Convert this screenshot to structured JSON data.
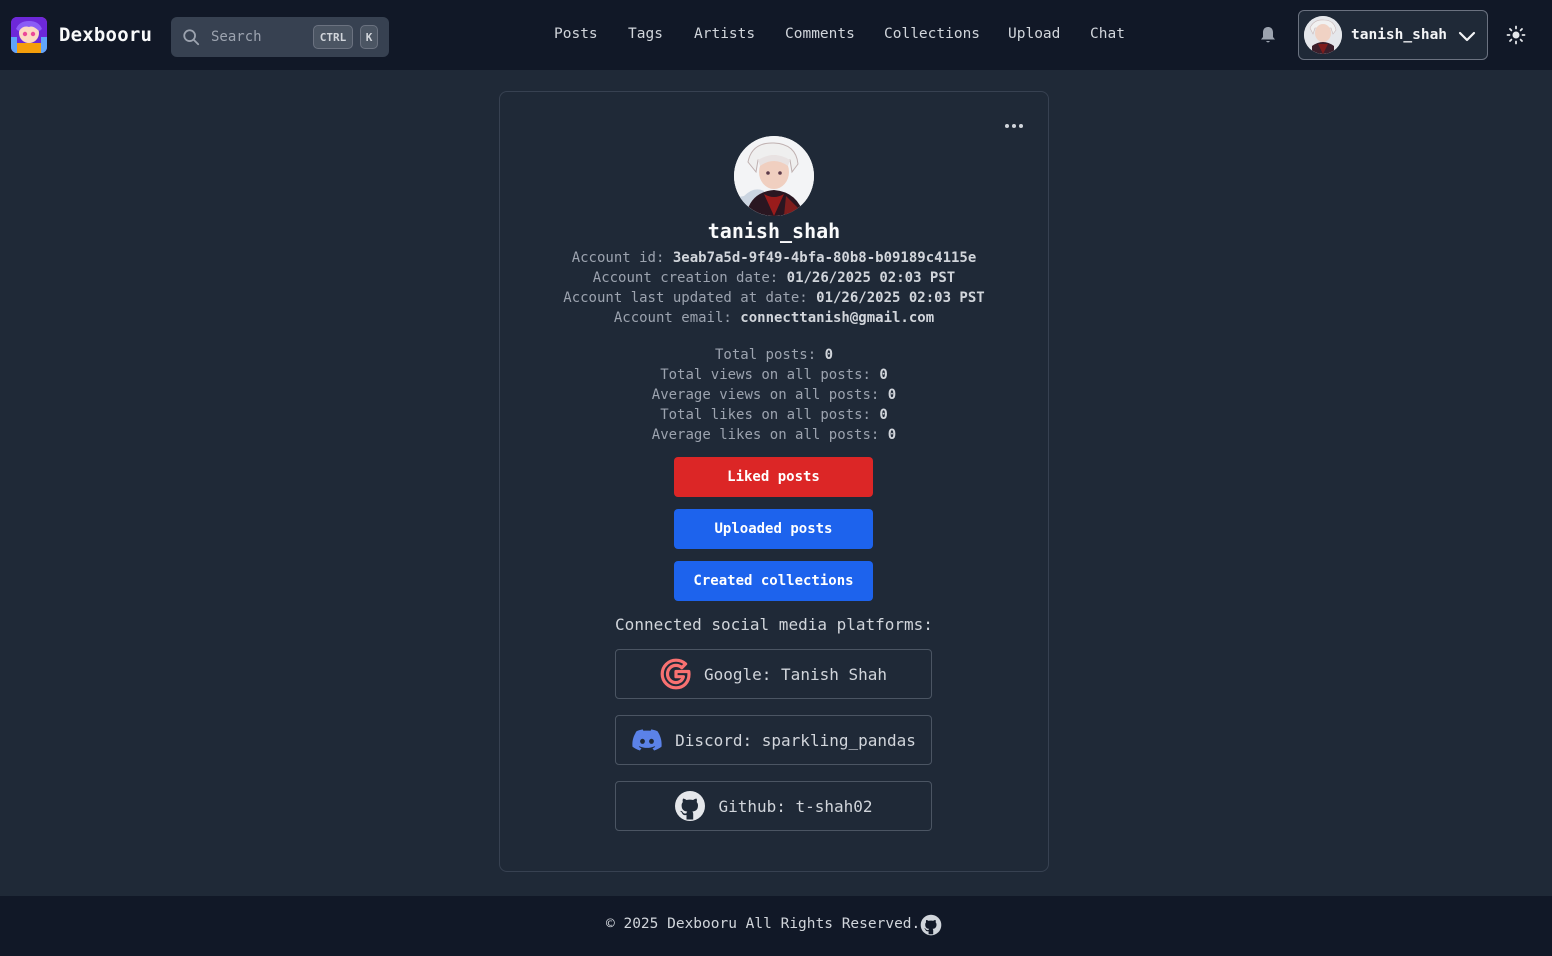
{
  "header": {
    "logo_text": "Dexbooru",
    "search": {
      "placeholder": "Search",
      "kbd_ctrl": "CTRL",
      "kbd_k": "K"
    },
    "nav": [
      "Posts",
      "Tags",
      "Artists",
      "Comments",
      "Collections",
      "Upload",
      "Chat"
    ],
    "user": {
      "name": "tanish_shah"
    }
  },
  "profile": {
    "username": "tanish_shah",
    "account": [
      {
        "label": "Account id: ",
        "value": "3eab7a5d-9f49-4bfa-80b8-b09189c4115e"
      },
      {
        "label": "Account creation date: ",
        "value": "01/26/2025 02:03 PST"
      },
      {
        "label": "Account last updated at date: ",
        "value": "01/26/2025 02:03 PST"
      },
      {
        "label": "Account email: ",
        "value": "connecttanish@gmail.com"
      }
    ],
    "stats": [
      {
        "label": "Total posts: ",
        "value": "0"
      },
      {
        "label": "Total views on all posts: ",
        "value": "0"
      },
      {
        "label": "Average views on all posts: ",
        "value": "0"
      },
      {
        "label": "Total likes on all posts: ",
        "value": "0"
      },
      {
        "label": "Average likes on all posts: ",
        "value": "0"
      }
    ],
    "buttons": {
      "liked": "Liked posts",
      "uploaded": "Uploaded posts",
      "collections": "Created collections"
    },
    "social_heading": "Connected social media platforms:",
    "socials": [
      {
        "platform": "Google",
        "text": "Google: Tanish Shah",
        "icon": "google-icon",
        "color": "#f87171"
      },
      {
        "platform": "Discord",
        "text": "Discord: sparkling_pandas",
        "icon": "discord-icon",
        "color": "#5b82e8"
      },
      {
        "platform": "Github",
        "text": "Github: t-shah02",
        "icon": "github-icon",
        "color": "#e5e7eb"
      }
    ]
  },
  "footer": {
    "text": "© 2025 Dexbooru All Rights Reserved."
  },
  "colors": {
    "background": "#1f2937",
    "header": "#111827",
    "danger": "#dc2626",
    "primary": "#1d63ed"
  }
}
